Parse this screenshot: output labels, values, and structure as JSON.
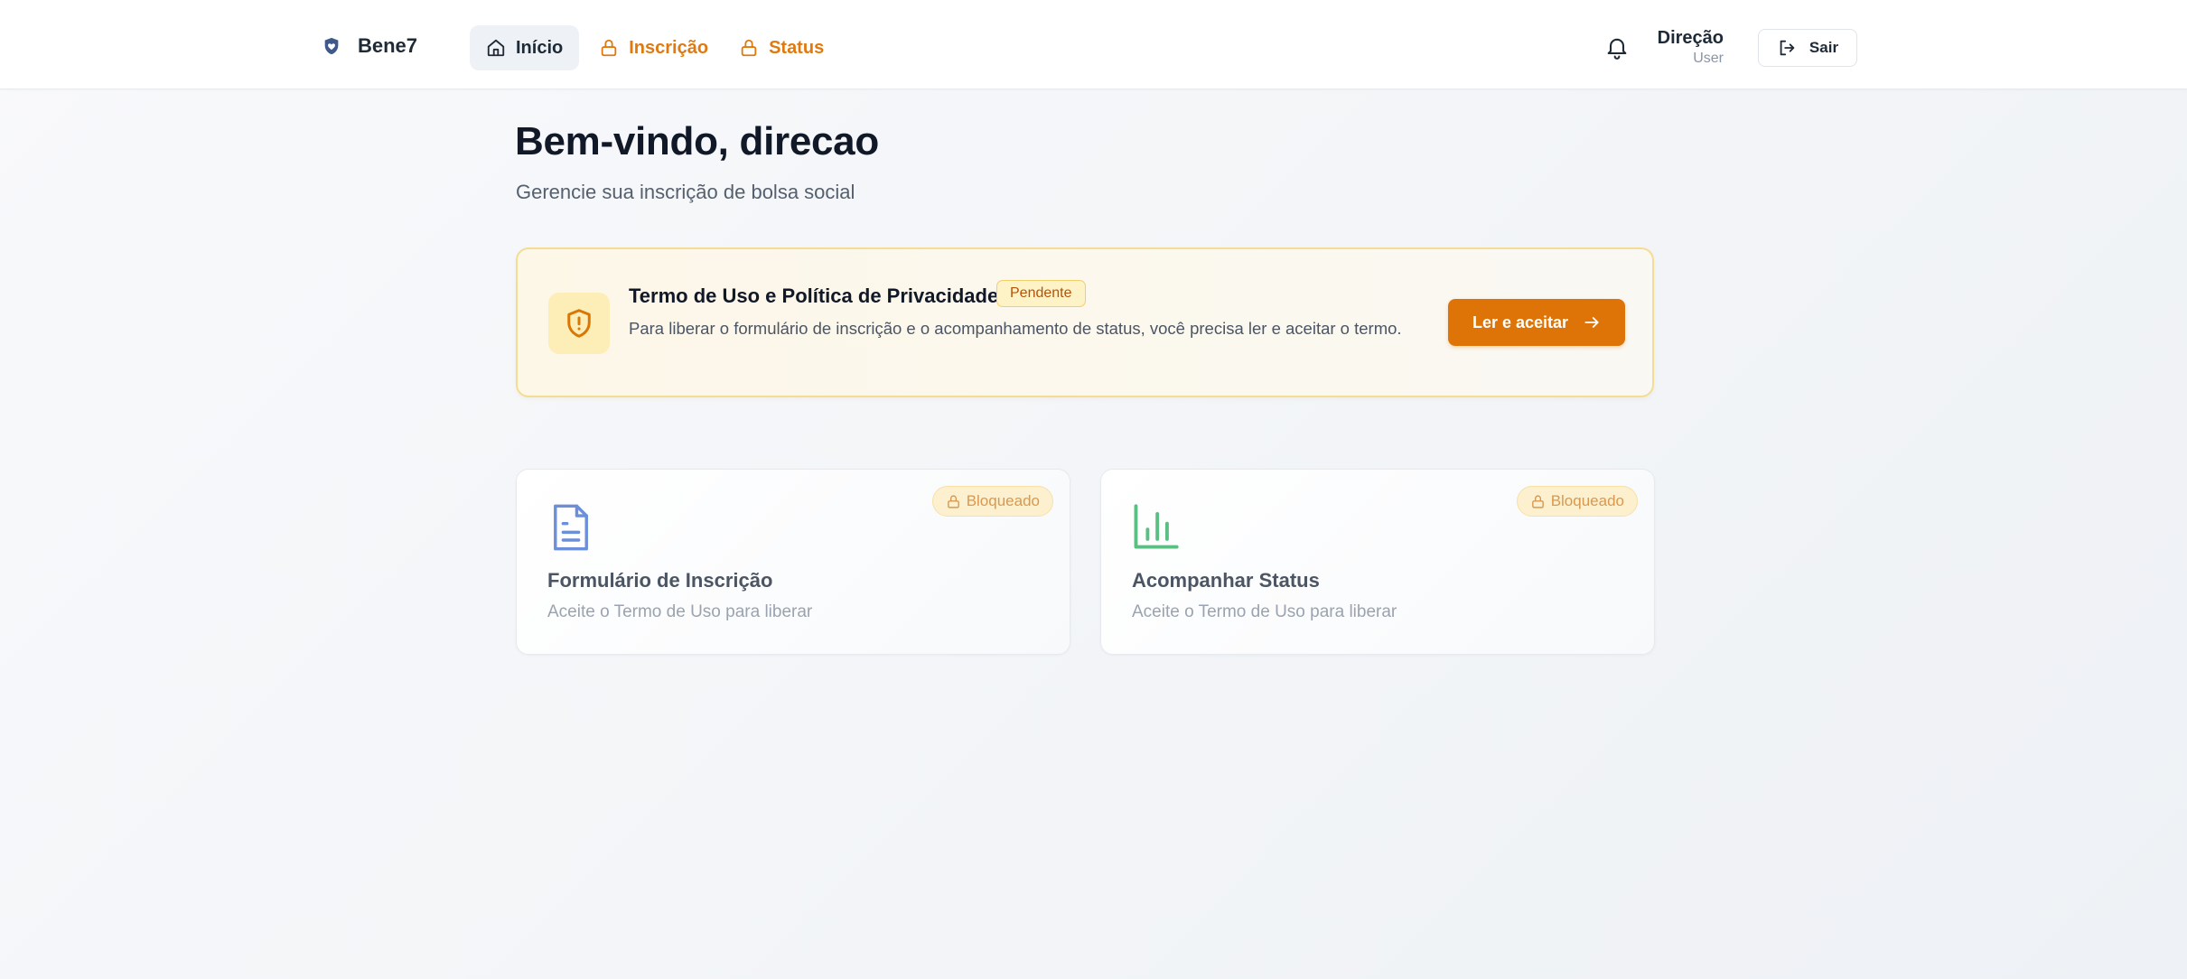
{
  "header": {
    "brand": "Bene7",
    "nav": [
      {
        "label": "Início",
        "icon": "home-icon",
        "state": "active"
      },
      {
        "label": "Inscrição",
        "icon": "lock-icon",
        "state": "locked"
      },
      {
        "label": "Status",
        "icon": "lock-icon",
        "state": "locked"
      }
    ],
    "user": {
      "name": "Direção",
      "role": "User"
    },
    "logout_label": "Sair"
  },
  "main": {
    "title": "Bem-vindo, direcao",
    "subtitle": "Gerencie sua inscrição de bolsa social",
    "terms_banner": {
      "title": "Termo de Uso e Política de Privacidade",
      "badge": "Pendente",
      "text": "Para liberar o formulário de inscrição e o acompanhamento de status, você precisa ler e aceitar o termo.",
      "button": "Ler e aceitar"
    },
    "cards": [
      {
        "title": "Formulário de Inscrição",
        "subtitle": "Aceite o Termo de Uso para liberar",
        "badge": "Bloqueado",
        "icon": "document-icon"
      },
      {
        "title": "Acompanhar Status",
        "subtitle": "Aceite o Termo de Uso para liberar",
        "badge": "Bloqueado",
        "icon": "bar-chart-icon"
      }
    ]
  },
  "colors": {
    "accent": "#de7408",
    "locked_text": "#e07a10",
    "banner_bg": "#fdf7e8",
    "banner_border": "#f4dc95",
    "doc_icon": "#6b8fd9",
    "chart_icon": "#5bbf84"
  }
}
